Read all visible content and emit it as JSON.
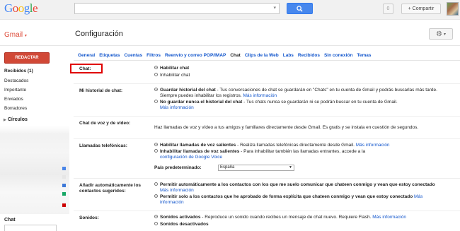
{
  "logo": {
    "letters": [
      "G",
      "o",
      "o",
      "g",
      "l",
      "e"
    ],
    "colors": [
      "#4285f4",
      "#ea4335",
      "#fbbc05",
      "#4285f4",
      "#34a853",
      "#ea4335"
    ]
  },
  "topbar": {
    "search_value": "",
    "notifications_count": "0",
    "share_label": "+ Compartir",
    "search_icon": "magnifier-icon"
  },
  "header": {
    "gmail_label": "Gmail",
    "page_title": "Configuración",
    "settings_icon": "gear-icon"
  },
  "left": {
    "compose_label": "REDACTAR",
    "nav": [
      "Recibidos (1)",
      "Destacados",
      "Importante",
      "Enviados",
      "Borradores"
    ],
    "circles_label": "Círculos",
    "chat_label": "Chat"
  },
  "tabs": [
    "General",
    "Etiquetas",
    "Cuentas",
    "Filtros",
    "Reenvío y correo POP/IMAP",
    "Chat",
    "Clips de la Web",
    "Labs",
    "Recibidos",
    "Sin conexión",
    "Temas"
  ],
  "active_tab": "Chat",
  "settings": {
    "chat": {
      "label": "Chat:",
      "opt1": "Habilitar chat",
      "opt2": "Inhabilitar chat"
    },
    "history": {
      "label": "Mi historial de chat:",
      "opt1_bold": "Guardar historial del chat",
      "opt1_text": " - Tus conversaciones de chat se guardarán en \"Chats\" en tu cuenta de Gmail y podrás buscarlas más tarde. Siempre puedes inhabilitar los registros.",
      "opt1_link": "Más información",
      "opt2_bold": "No guardar nunca el historial del chat",
      "opt2_text": " - Tus chats nunca se guardarán ni se podrán buscar en tu cuenta de Gmail.",
      "opt2_link": "Más información"
    },
    "voice": {
      "label": "Chat de voz y de vídeo:",
      "text": "Haz llamadas de voz y vídeo a tus amigos y familiares directamente desde Gmail. Es gratis y se instala en cuestión de segundos."
    },
    "calls": {
      "label": "Llamadas telefónicas:",
      "opt1_bold": "Habilitar llamadas de voz salientes",
      "opt1_text": " - Realiza llamadas telefónicas directamente desde Gmail.",
      "opt1_link": "Más información",
      "opt2_bold": "Inhabilitar llamadas de voz salientes",
      "opt2_text": " - Para inhabilitar también las llamadas entrantes, accede a la",
      "opt2_link": "configuración de Google Voice",
      "country_label": "País predeterminado:",
      "country_value": "España"
    },
    "auto_add": {
      "label1": "Añadir automáticamente los",
      "label2": "contactos sugeridos:",
      "opt1_bold": "Permitir automáticamente a los contactos con los que me suelo comunicar que chateen conmigo y vean que estoy conectado",
      "opt1_link": "Más información",
      "opt2_bold": "Permitir solo a los contactos que he aprobado de forma explícita que chateen conmigo y vean que estoy conectado",
      "opt2_link": "Más información"
    },
    "sounds": {
      "label": "Sonidos:",
      "opt1_bold": "Sonidos activados",
      "opt1_text": " - Reproduce un sonido cuando recibes un mensaje de chat nuevo. Requiere Flash.",
      "opt1_link": "Más información",
      "opt2_bold": "Sonidos desactivados"
    }
  }
}
